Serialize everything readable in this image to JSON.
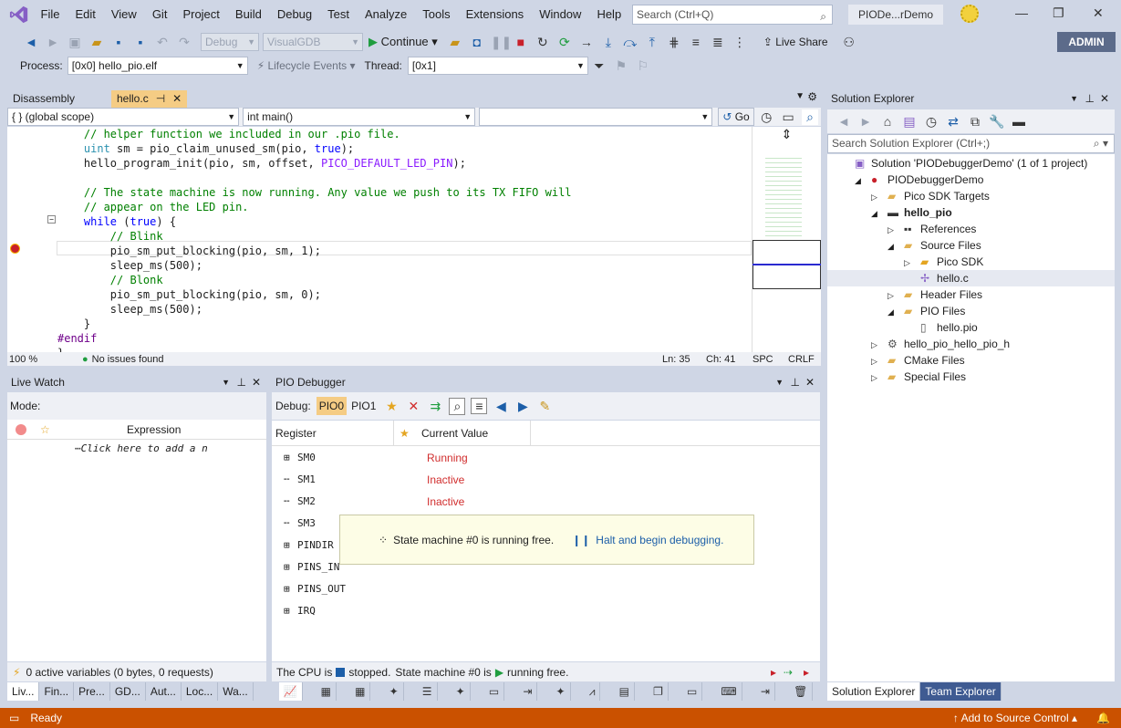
{
  "menu": {
    "items": [
      "File",
      "Edit",
      "View",
      "Git",
      "Project",
      "Build",
      "Debug",
      "Test",
      "Analyze",
      "Tools",
      "Extensions",
      "Window",
      "Help"
    ],
    "search_placeholder": "Search (Ctrl+Q)",
    "solution_badge": "PIODe...rDemo"
  },
  "toolbar": {
    "config": "Debug",
    "platform": "VisualGDB",
    "continue_label": "Continue",
    "live_share": "Live Share",
    "admin": "ADMIN",
    "process_label": "Process:",
    "process_value": "[0x0] hello_pio.elf",
    "lifecycle": "Lifecycle Events",
    "thread_label": "Thread:",
    "thread_value": "[0x1]"
  },
  "editor": {
    "tabs": [
      "Disassembly",
      "hello.c"
    ],
    "scope": "{ } (global scope)",
    "function": "int main()",
    "go": "Go",
    "lines": [
      {
        "t": "    // helper function we included in our .pio file.",
        "c": "cm"
      },
      {
        "t": "    uint sm = pio_claim_unused_sm(pio, true);",
        "c": ""
      },
      {
        "t": "    hello_program_init(pio, sm, offset, PICO_DEFAULT_LED_PIN);",
        "c": ""
      },
      {
        "t": "",
        "c": ""
      },
      {
        "t": "    // The state machine is now running. Any value we push to its TX FIFO will",
        "c": "cm"
      },
      {
        "t": "    // appear on the LED pin.",
        "c": "cm"
      },
      {
        "t": "    while (true) {",
        "c": ""
      },
      {
        "t": "        // Blink",
        "c": "cm"
      },
      {
        "t": "        pio_sm_put_blocking(pio, sm, 1);",
        "c": ""
      },
      {
        "t": "        sleep_ms(500);",
        "c": ""
      },
      {
        "t": "        // Blonk",
        "c": "cm"
      },
      {
        "t": "        pio_sm_put_blocking(pio, sm, 0);",
        "c": ""
      },
      {
        "t": "        sleep_ms(500);",
        "c": ""
      },
      {
        "t": "    }",
        "c": ""
      },
      {
        "t": "#endif",
        "c": "pp"
      },
      {
        "t": "}",
        "c": ""
      }
    ],
    "zoom": "100 %",
    "issues": "No issues found",
    "ln": "Ln: 35",
    "ch": "Ch: 41",
    "spc": "SPC",
    "crlf": "CRLF"
  },
  "solution_explorer": {
    "title": "Solution Explorer",
    "search_placeholder": "Search Solution Explorer (Ctrl+;)",
    "items": [
      {
        "label": "Solution 'PIODebuggerDemo' (1 of 1 project)",
        "indent": 0,
        "exp": ""
      },
      {
        "label": "PIODebuggerDemo",
        "indent": 1,
        "exp": "◢"
      },
      {
        "label": "Pico SDK Targets",
        "indent": 2,
        "exp": "▷"
      },
      {
        "label": "hello_pio",
        "indent": 2,
        "exp": "◢",
        "bold": true
      },
      {
        "label": "References",
        "indent": 3,
        "exp": "▷"
      },
      {
        "label": "Source Files",
        "indent": 3,
        "exp": "◢"
      },
      {
        "label": "Pico SDK",
        "indent": 4,
        "exp": "▷"
      },
      {
        "label": "hello.c",
        "indent": 4,
        "exp": "",
        "sel": true
      },
      {
        "label": "Header Files",
        "indent": 3,
        "exp": "▷"
      },
      {
        "label": "PIO Files",
        "indent": 3,
        "exp": "◢"
      },
      {
        "label": "hello.pio",
        "indent": 4,
        "exp": ""
      },
      {
        "label": "hello_pio_hello_pio_h",
        "indent": 2,
        "exp": "▷"
      },
      {
        "label": "CMake Files",
        "indent": 2,
        "exp": "▷"
      },
      {
        "label": "Special Files",
        "indent": 2,
        "exp": "▷"
      }
    ],
    "bottom_tabs": [
      "Solution Explorer",
      "Team Explorer"
    ]
  },
  "live_watch": {
    "title": "Live Watch",
    "mode_label": "Mode:",
    "col_expression": "Expression",
    "add_hint": "Click here to add a n",
    "status": "0 active variables (0 bytes, 0 requests)",
    "bottom_tabs": [
      "Liv...",
      "Fin...",
      "Pre...",
      "GD...",
      "Aut...",
      "Loc...",
      "Wa..."
    ]
  },
  "pio_debugger": {
    "title": "PIO Debugger",
    "debug_label": "Debug:",
    "pio_tabs": [
      "PIO0",
      "PIO1"
    ],
    "col_register": "Register",
    "col_value": "Current Value",
    "rows": [
      {
        "name": "SM0",
        "value": "Running",
        "exp": true
      },
      {
        "name": "SM1",
        "value": "Inactive",
        "exp": false
      },
      {
        "name": "SM2",
        "value": "Inactive",
        "exp": false
      },
      {
        "name": "SM3",
        "value": "",
        "exp": false
      },
      {
        "name": "PINDIR",
        "value": "",
        "exp": true
      },
      {
        "name": "PINS_IN",
        "value": "",
        "exp": true
      },
      {
        "name": "PINS_OUT",
        "value": "",
        "exp": true
      },
      {
        "name": "IRQ",
        "value": "",
        "exp": true
      }
    ],
    "tooltip_msg": "State machine #0 is running free.",
    "tooltip_link": "Halt and begin debugging.",
    "status_a": "The CPU is",
    "status_b": "stopped.",
    "status_c": "State machine #0 is",
    "status_d": "running free."
  },
  "status": {
    "ready": "Ready",
    "source_control": "Add to Source Control"
  },
  "colors": {
    "accent": "#ca5100",
    "tab_active": "#f5cc84",
    "chrome": "#cfd6e5"
  }
}
